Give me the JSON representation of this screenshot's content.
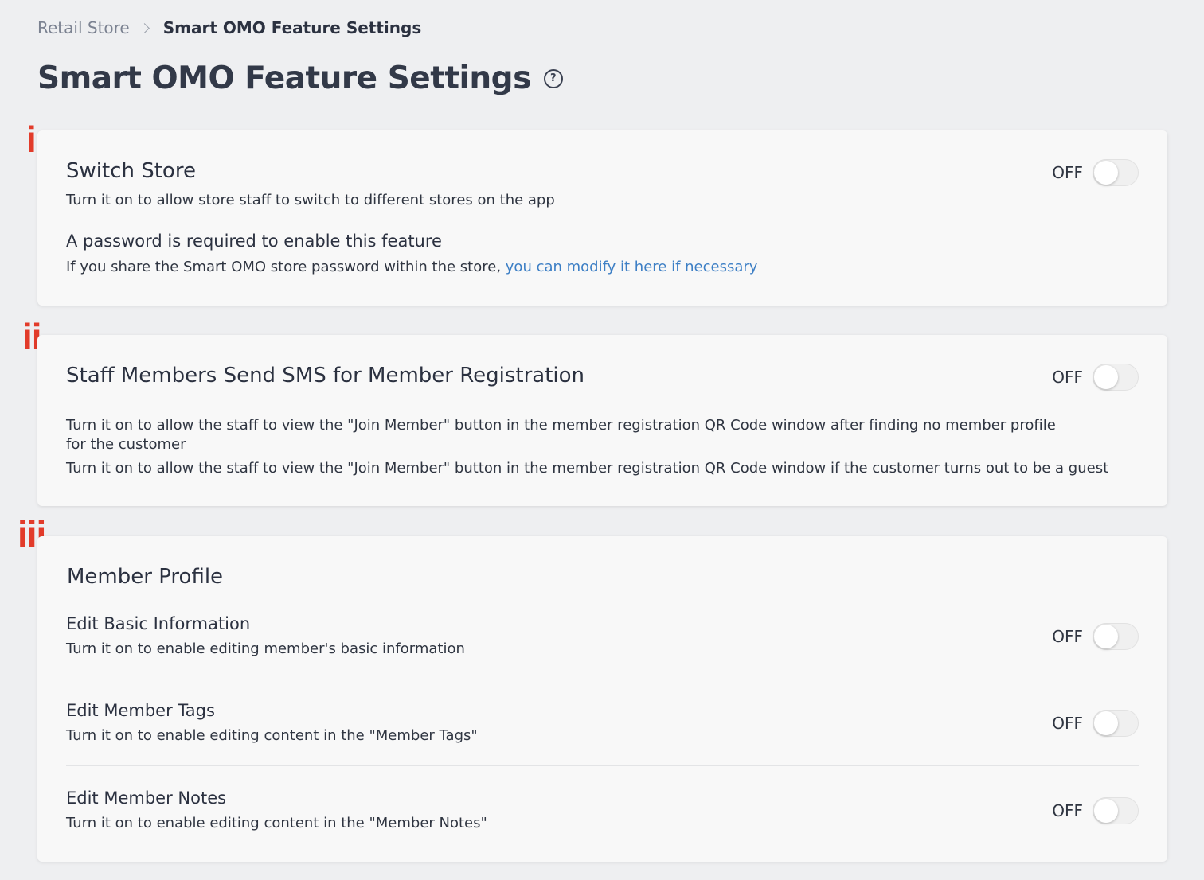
{
  "breadcrumb": {
    "root": "Retail Store",
    "current": "Smart OMO Feature Settings"
  },
  "page": {
    "title": "Smart OMO Feature Settings",
    "help_icon": "question-circle-icon"
  },
  "markers": {
    "first": "i.",
    "second": "ii.",
    "third": "iii."
  },
  "switch_store": {
    "title": "Switch Store",
    "description": "Turn it on to allow store staff to switch to different stores on the app",
    "toggle_label": "OFF",
    "password_heading": "A password is required to enable this feature",
    "password_text": "If you share the Smart OMO store password within the store, ",
    "password_link": "you can modify it here if necessary"
  },
  "sms_registration": {
    "title": "Staff Members Send SMS for Member Registration",
    "toggle_label": "OFF",
    "description_1": "Turn it on to allow the staff to view the \"Join Member\" button in the member registration QR Code window after finding no member profile for the customer",
    "description_2": "Turn it on to allow the staff to view the \"Join Member\" button in the member registration QR Code window if the customer turns out to be a guest"
  },
  "member_profile": {
    "title": "Member Profile",
    "items": [
      {
        "title": "Edit Basic Information",
        "description": "Turn it on to enable editing member's basic information",
        "toggle_label": "OFF"
      },
      {
        "title": "Edit Member Tags",
        "description": "Turn it on to enable editing content in the \"Member Tags\"",
        "toggle_label": "OFF"
      },
      {
        "title": "Edit Member Notes",
        "description": "Turn it on to enable editing content in the \"Member Notes\"",
        "toggle_label": "OFF"
      }
    ]
  },
  "colors": {
    "background": "#eeeff1",
    "card": "#f8f8f8",
    "marker": "#e23b2a",
    "link": "#3d7fc5"
  }
}
